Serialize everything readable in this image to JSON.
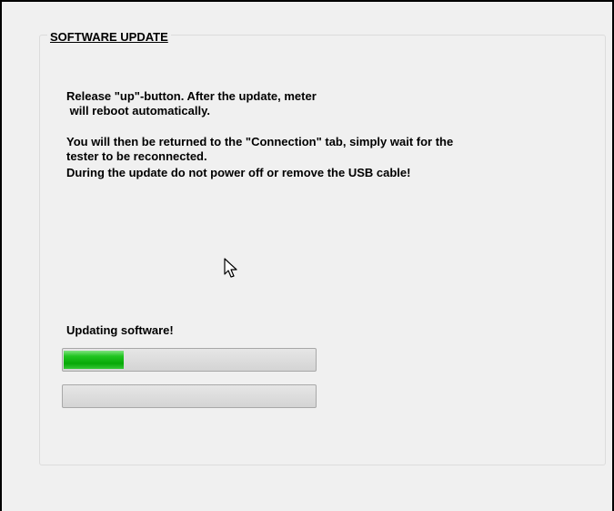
{
  "group": {
    "title": "SOFTWARE UPDATE"
  },
  "messages": {
    "line1": "Release \"up\"-button. After the update, meter\n will reboot automatically.",
    "line2": "You will then be returned to the \"Connection\" tab, simply wait for the\ntester to be reconnected.",
    "line3": "During the update do not power off or remove the USB cable!"
  },
  "status": {
    "label": "Updating software!"
  },
  "progress": {
    "primary_fraction": 0.24,
    "secondary_fraction": 0.0,
    "fill_color": "#12b812"
  },
  "icons": {
    "cursor": "arrow-cursor-icon"
  }
}
